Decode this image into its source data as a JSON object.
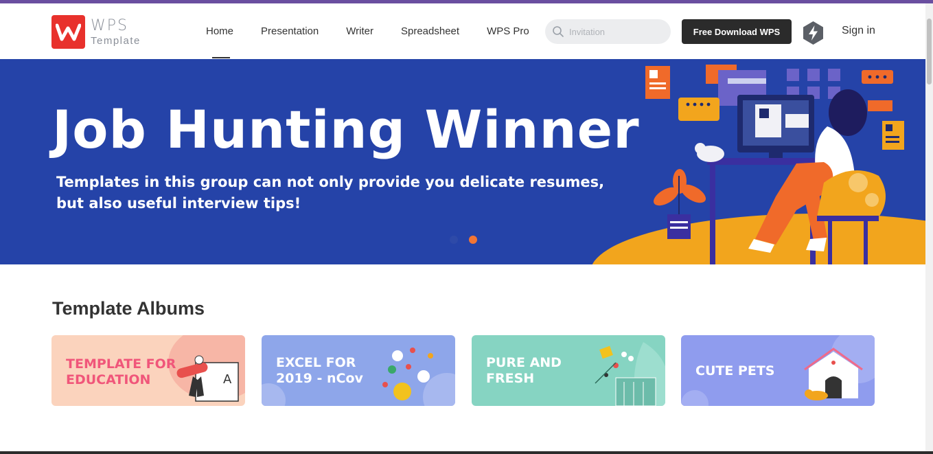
{
  "header": {
    "logo_wordmark": "WPS",
    "logo_subtitle": "Template",
    "nav": [
      {
        "label": "Home",
        "active": true
      },
      {
        "label": "Presentation",
        "active": false
      },
      {
        "label": "Writer",
        "active": false
      },
      {
        "label": "Spreadsheet",
        "active": false
      },
      {
        "label": "WPS Pro",
        "active": false
      }
    ],
    "search": {
      "placeholder": "Invitation",
      "icon": "search-icon"
    },
    "download_label": "Free Download WPS",
    "pro_icon": "lightning-icon",
    "signin_label": "Sign in"
  },
  "banner": {
    "title": "Job Hunting Winner",
    "subtitle": "Templates in this group can not only provide you delicate resumes, but also useful interview tips!",
    "background_color": "#2543a8",
    "carousel": {
      "count": 2,
      "active_index": 1
    }
  },
  "albums": {
    "title": "Template Albums",
    "items": [
      {
        "label": "TEMPLATE FOR\nEDUCATION",
        "color": "#fbd3bd",
        "text_color": "#f0567a"
      },
      {
        "label": "EXCEL FOR\n2019 - nCov",
        "color": "#8ea6ea",
        "text_color": "#ffffff"
      },
      {
        "label": "PURE AND\nFRESH",
        "color": "#86d4c2",
        "text_color": "#ffffff"
      },
      {
        "label": "CUTE PETS",
        "color": "#8f9cee",
        "text_color": "#ffffff"
      }
    ]
  },
  "colors": {
    "brand_red": "#e8312c",
    "accent_orange": "#f27535",
    "button_dark": "#2b2b2b"
  }
}
